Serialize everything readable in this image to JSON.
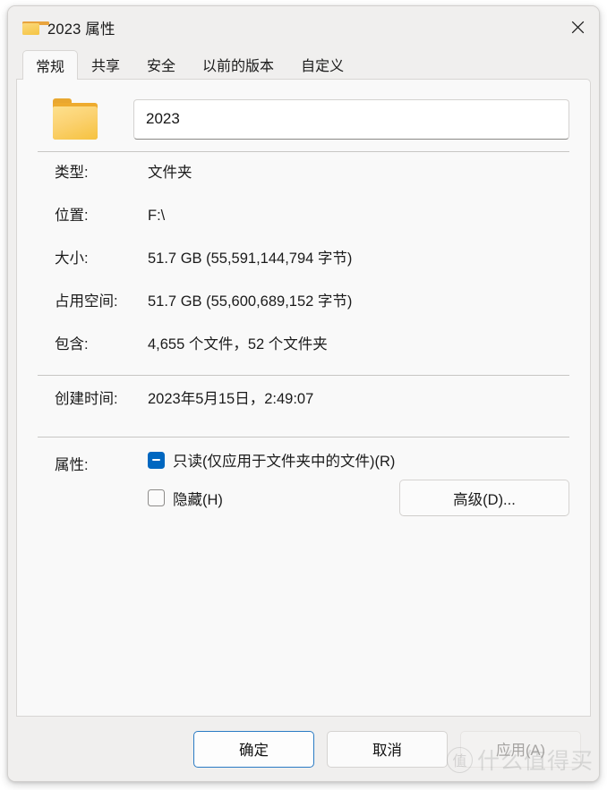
{
  "window": {
    "title": "2023 属性",
    "icon": "folder-icon",
    "close_label": "✕"
  },
  "tabs": [
    {
      "label": "常规",
      "active": true
    },
    {
      "label": "共享",
      "active": false
    },
    {
      "label": "安全",
      "active": false
    },
    {
      "label": "以前的版本",
      "active": false
    },
    {
      "label": "自定义",
      "active": false
    }
  ],
  "general": {
    "folder_icon": "folder-icon",
    "name_value": "2023",
    "properties": [
      {
        "label": "类型:",
        "value": "文件夹"
      },
      {
        "label": "位置:",
        "value": "F:\\"
      },
      {
        "label": "大小:",
        "value": "51.7 GB (55,591,144,794 字节)"
      },
      {
        "label": "占用空间:",
        "value": "51.7 GB (55,600,689,152 字节)"
      },
      {
        "label": "包含:",
        "value": "4,655 个文件，52 个文件夹"
      }
    ],
    "created": {
      "label": "创建时间:",
      "value": "2023年5月15日，2:49:07"
    },
    "attributes": {
      "label": "属性:",
      "readonly": {
        "label": "只读(仅应用于文件夹中的文件)(R)",
        "state": "indeterminate"
      },
      "hidden": {
        "label": "隐藏(H)",
        "state": "unchecked"
      },
      "advanced_label": "高级(D)..."
    }
  },
  "footer": {
    "ok_label": "确定",
    "cancel_label": "取消",
    "apply_label": "应用(A)"
  },
  "watermark": {
    "badge": "值",
    "text": "什么值得买"
  },
  "colors": {
    "accent": "#0067c0",
    "default_button_border": "#2a7bc4",
    "folder_yellow": "#f6c23f",
    "window_bg": "#f0efee",
    "panel_bg": "#f9f9f9"
  }
}
